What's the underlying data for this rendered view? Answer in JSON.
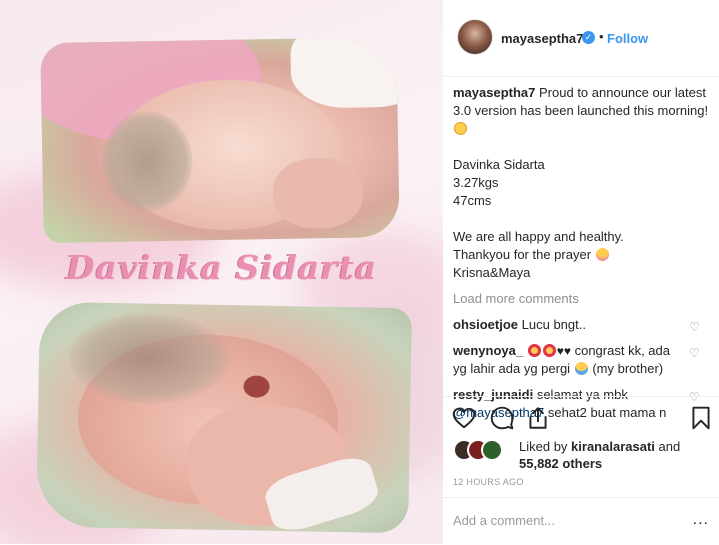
{
  "post": {
    "photo_text": "Davinka Sidarta",
    "author": {
      "username": "mayaseptha7",
      "verified": true,
      "separator": "•",
      "follow_label": "Follow"
    },
    "caption": {
      "username": "mayaseptha7",
      "line1": "Proud to announce our latest 3.0 version has been launched this morning!",
      "name": "Davinka Sidarta",
      "weight": "3.27kgs",
      "length": "47cms",
      "line2": "We are all happy and healthy.",
      "line3": "Thankyou for the prayer",
      "line4": "Krisna&Maya"
    },
    "load_more": "Load more comments",
    "comments": [
      {
        "username": "ohsioetjoe",
        "text": "Lucu bngt.."
      },
      {
        "username": "wenynoya_",
        "text_a": "congrast kk, ada yg lahir ada yg pergi",
        "text_b": "(my brother)"
      },
      {
        "username": "resty_junaidi",
        "text_a": "selamat ya mbk",
        "mention": "@mayaseptha7",
        "text_b": "sehat2 buat mama n"
      }
    ],
    "likes": {
      "prefix": "Liked by",
      "user": "kiranalarasati",
      "conj": "and",
      "count": "55,882",
      "suffix": "others"
    },
    "timestamp": "12 HOURS AGO",
    "comment_placeholder": "Add a comment...",
    "more_label": "...",
    "icons": {
      "like": "heart-outline-icon",
      "comment": "speech-bubble-icon",
      "share": "share-icon",
      "save": "bookmark-icon"
    },
    "colors": {
      "link_blue": "#3897f0",
      "muted": "#8e8e8e",
      "name_pink": "#e98fb2"
    }
  }
}
